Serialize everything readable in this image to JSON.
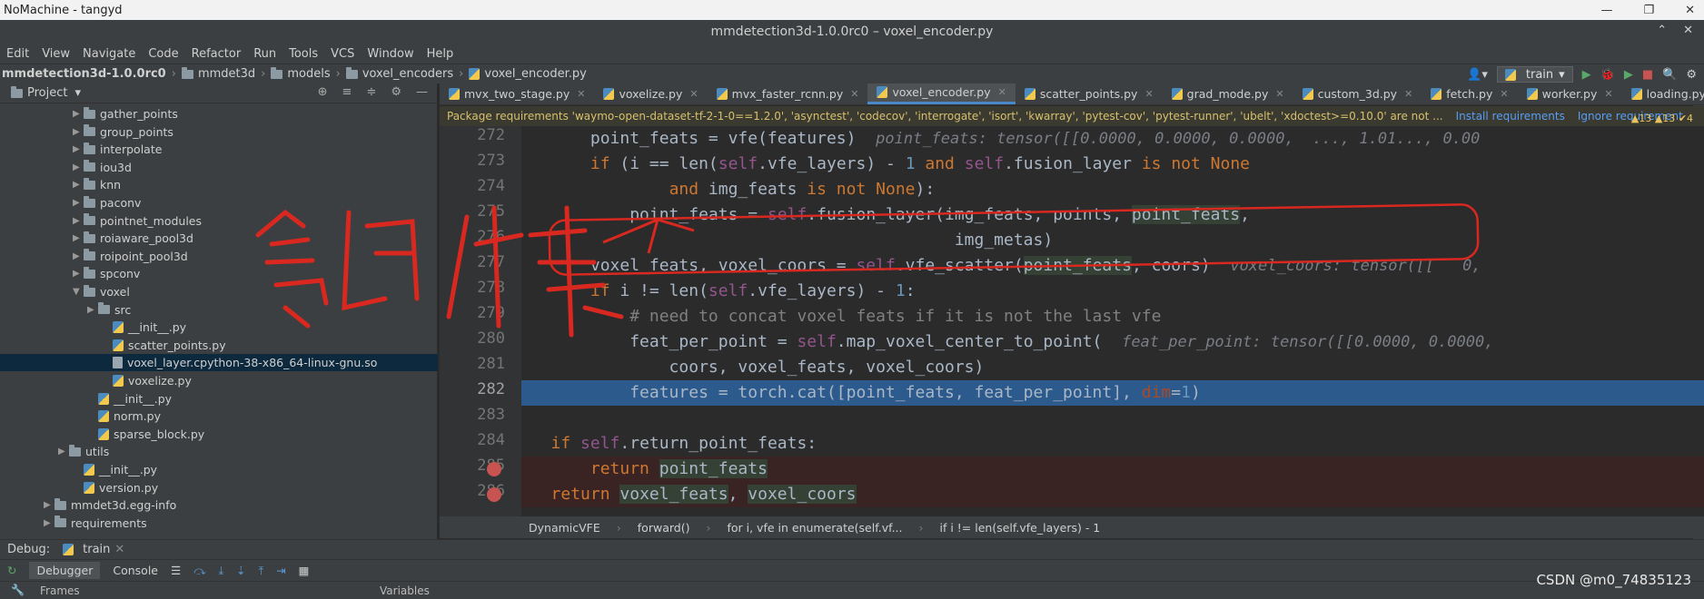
{
  "nomachine": {
    "title": "NoMachine - tangyd"
  },
  "ide": {
    "title": "mmdetection3d-1.0.0rc0 – voxel_encoder.py"
  },
  "menu": [
    "Edit",
    "View",
    "Navigate",
    "Code",
    "Refactor",
    "Run",
    "Tools",
    "VCS",
    "Window",
    "Help"
  ],
  "breadcrumb": [
    "mmdetection3d-1.0.0rc0",
    "mmdet3d",
    "models",
    "voxel_encoders",
    "voxel_encoder.py"
  ],
  "run_config": "train",
  "project": {
    "title": "Project",
    "tree": [
      {
        "label": "gather_points",
        "type": "folder",
        "indent": 1,
        "arrow": "▶"
      },
      {
        "label": "group_points",
        "type": "folder",
        "indent": 1,
        "arrow": "▶"
      },
      {
        "label": "interpolate",
        "type": "folder",
        "indent": 1,
        "arrow": "▶"
      },
      {
        "label": "iou3d",
        "type": "folder",
        "indent": 1,
        "arrow": "▶"
      },
      {
        "label": "knn",
        "type": "folder",
        "indent": 1,
        "arrow": "▶"
      },
      {
        "label": "paconv",
        "type": "folder",
        "indent": 1,
        "arrow": "▶"
      },
      {
        "label": "pointnet_modules",
        "type": "folder",
        "indent": 1,
        "arrow": "▶"
      },
      {
        "label": "roiaware_pool3d",
        "type": "folder",
        "indent": 1,
        "arrow": "▶"
      },
      {
        "label": "roipoint_pool3d",
        "type": "folder",
        "indent": 1,
        "arrow": "▶"
      },
      {
        "label": "spconv",
        "type": "folder",
        "indent": 1,
        "arrow": "▶"
      },
      {
        "label": "voxel",
        "type": "folder",
        "indent": 1,
        "arrow": "▼"
      },
      {
        "label": "src",
        "type": "folder",
        "indent": 2,
        "arrow": "▶"
      },
      {
        "label": "__init__.py",
        "type": "py",
        "indent": 3,
        "arrow": ""
      },
      {
        "label": "scatter_points.py",
        "type": "py",
        "indent": 3,
        "arrow": ""
      },
      {
        "label": "voxel_layer.cpython-38-x86_64-linux-gnu.so",
        "type": "so",
        "indent": 3,
        "arrow": "",
        "selected": true
      },
      {
        "label": "voxelize.py",
        "type": "py",
        "indent": 3,
        "arrow": ""
      },
      {
        "label": "__init__.py",
        "type": "py",
        "indent": 2,
        "arrow": ""
      },
      {
        "label": "norm.py",
        "type": "py",
        "indent": 2,
        "arrow": ""
      },
      {
        "label": "sparse_block.py",
        "type": "py",
        "indent": 2,
        "arrow": ""
      },
      {
        "label": "utils",
        "type": "folder",
        "indent": 0,
        "arrow": "▶"
      },
      {
        "label": "__init__.py",
        "type": "py",
        "indent": 1,
        "arrow": ""
      },
      {
        "label": "version.py",
        "type": "py",
        "indent": 1,
        "arrow": ""
      },
      {
        "label": "mmdet3d.egg-info",
        "type": "folder",
        "indent": -1,
        "arrow": "▶"
      },
      {
        "label": "requirements",
        "type": "folder",
        "indent": -1,
        "arrow": "▶"
      }
    ]
  },
  "tabs": [
    {
      "label": "mvx_two_stage.py"
    },
    {
      "label": "voxelize.py"
    },
    {
      "label": "mvx_faster_rcnn.py"
    },
    {
      "label": "voxel_encoder.py",
      "active": true
    },
    {
      "label": "scatter_points.py"
    },
    {
      "label": "grad_mode.py"
    },
    {
      "label": "custom_3d.py"
    },
    {
      "label": "fetch.py"
    },
    {
      "label": "worker.py"
    },
    {
      "label": "loading.py"
    }
  ],
  "banner": {
    "text": "Package requirements 'waymo-open-dataset-tf-2-1-0==1.2.0', 'asynctest', 'codecov', 'interrogate', 'isort', 'kwarray', 'pytest-cov', 'pytest-runner', 'ubelt', 'xdoctest>=0.10.0' are not ...",
    "install": "Install requirements",
    "ignore": "Ignore requirement"
  },
  "inspections": "▲13  ▲13  ✔4",
  "line_numbers": [
    "272",
    "273",
    "274",
    "275",
    "276",
    "277",
    "278",
    "279",
    "280",
    "281",
    "282",
    "283",
    "284",
    "285",
    "286"
  ],
  "code_hints": {
    "l272": "point_feats: tensor([[0.0000, 0.0000, 0.0000,  ..., 1.01..., 0.00",
    "l277": "voxel_coors: tensor([[   0,",
    "l280": "feat_per_point: tensor([[0.0000, 0.0000,"
  },
  "editor_crumbs": [
    "DynamicVFE",
    "forward()",
    "for i, vfe in enumerate(self.vf...",
    "if i != len(self.vfe_layers) - 1"
  ],
  "debug": {
    "label": "Debug:",
    "config": "train",
    "tabs": [
      "Debugger",
      "Console"
    ],
    "frames": "Frames",
    "variables": "Variables"
  },
  "watermark": "CSDN @m0_74835123"
}
